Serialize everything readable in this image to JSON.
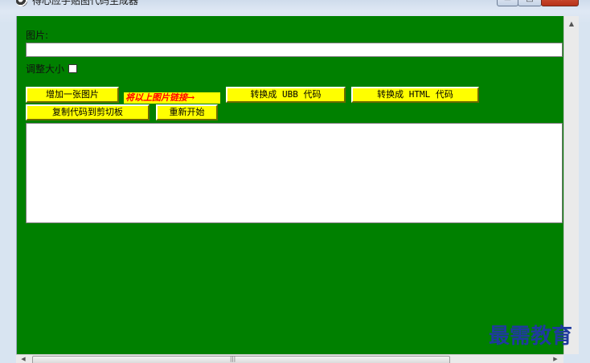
{
  "window": {
    "title": "得心应手贴图代码生成器",
    "app_icon": "app-icon",
    "caption_buttons": {
      "minimize_glyph": "▭",
      "maximize_glyph": "□",
      "close_glyph": "✕"
    }
  },
  "form": {
    "image_label": "图片:",
    "image_input_value": "",
    "resize_label": "调整大小",
    "resize_checked": false,
    "add_image_button": "增加一张图片",
    "hint_text": "将以上图片链接→",
    "to_ubb_button": "转换成 UBB 代码",
    "to_html_button": "转换成 HTML 代码",
    "copy_button": "复制代码到剪切板",
    "restart_button": "重新开始",
    "output_value": ""
  },
  "scrollbars": {
    "grip": "|||",
    "up_arrow": "▲",
    "left_arrow": "◀",
    "right_arrow": "▶"
  },
  "watermark": "最需教育",
  "colors": {
    "client_background": "#008000",
    "button_background": "#ffff00",
    "hint_text": "#ff0000",
    "watermark": "#1f3a9e"
  }
}
